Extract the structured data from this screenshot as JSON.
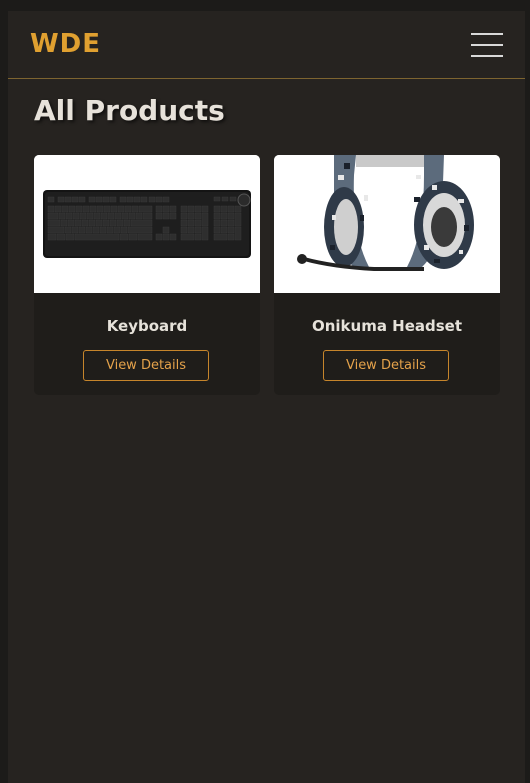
{
  "navbar": {
    "logo": "WDE",
    "menu_icon": "hamburger-menu-icon"
  },
  "main": {
    "title": "All Products",
    "products": [
      {
        "name": "Keyboard",
        "image": "keyboard",
        "button_label": "View Details"
      },
      {
        "name": "Onikuma Headset",
        "image": "headset",
        "button_label": "View Details"
      }
    ]
  },
  "colors": {
    "accent": "#e0a030",
    "background": "#262320",
    "card": "#1f1d1a",
    "button_border": "#c6852b"
  }
}
